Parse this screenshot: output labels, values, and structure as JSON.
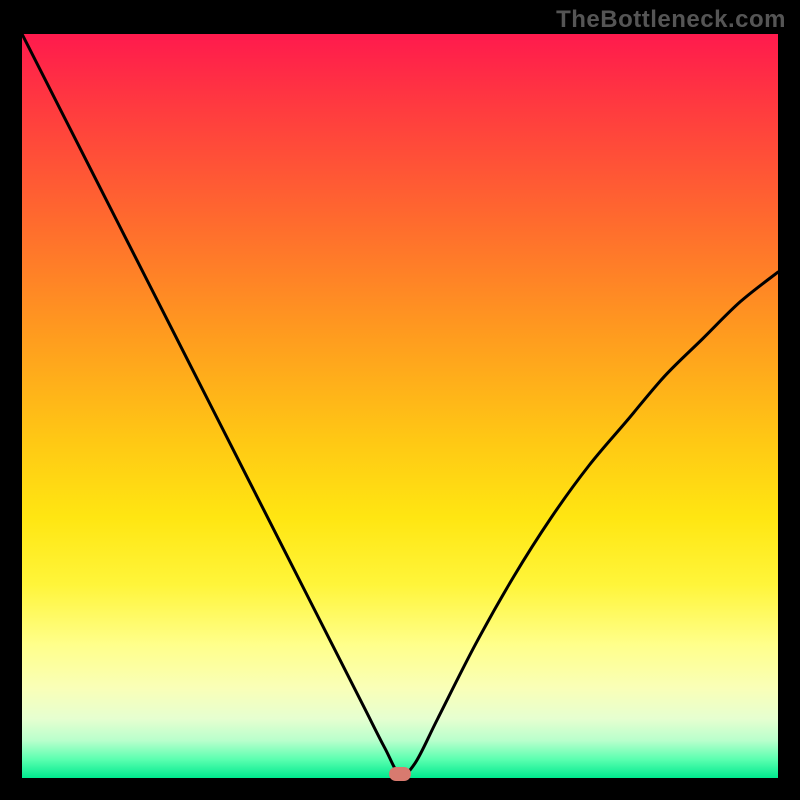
{
  "watermark": "TheBottleneck.com",
  "chart_data": {
    "type": "line",
    "title": "",
    "xlabel": "",
    "ylabel": "",
    "xlim": [
      0,
      100
    ],
    "ylim": [
      0,
      100
    ],
    "grid": false,
    "legend": false,
    "series": [
      {
        "name": "bottleneck-curve",
        "x": [
          0,
          5,
          10,
          15,
          20,
          25,
          30,
          35,
          40,
          45,
          48,
          50,
          52,
          55,
          60,
          65,
          70,
          75,
          80,
          85,
          90,
          95,
          100
        ],
        "values": [
          100,
          90,
          80,
          70,
          60,
          50,
          40,
          30,
          20,
          10,
          4,
          0.5,
          2,
          8,
          18,
          27,
          35,
          42,
          48,
          54,
          59,
          64,
          68
        ]
      }
    ],
    "marker": {
      "x": 50,
      "y": 0.5
    },
    "background_gradient": {
      "top": "#ff1a4d",
      "mid": "#ffe612",
      "bottom": "#00e98e"
    }
  }
}
